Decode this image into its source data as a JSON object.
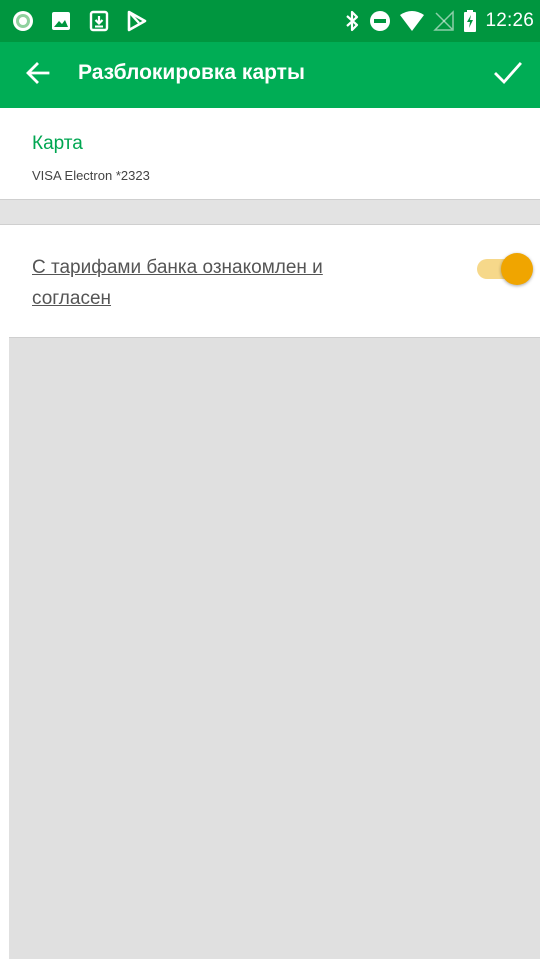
{
  "status_bar": {
    "time": "12:26",
    "left_icons": [
      "app-logo-icon",
      "image-icon",
      "download-icon",
      "google-play-icon"
    ],
    "right_icons": [
      "bluetooth-icon",
      "do-not-disturb-icon",
      "wifi-icon",
      "no-sim-icon",
      "battery-charging-icon"
    ]
  },
  "app_bar": {
    "title": "Разблокировка карты",
    "back_icon": "arrow-back-icon",
    "confirm_icon": "checkmark-icon"
  },
  "card": {
    "label": "Карта",
    "number": "VISA Electron *2323"
  },
  "agreement": {
    "text": "С тарифами банка ознакомлен и согласен",
    "toggle_on": true
  },
  "colors": {
    "status_bar": "#00963f",
    "app_bar": "#00ad55",
    "accent_green": "#00a651",
    "toggle_thumb": "#f0a500",
    "toggle_track": "#f6d88a",
    "background": "#e0e0e0"
  }
}
